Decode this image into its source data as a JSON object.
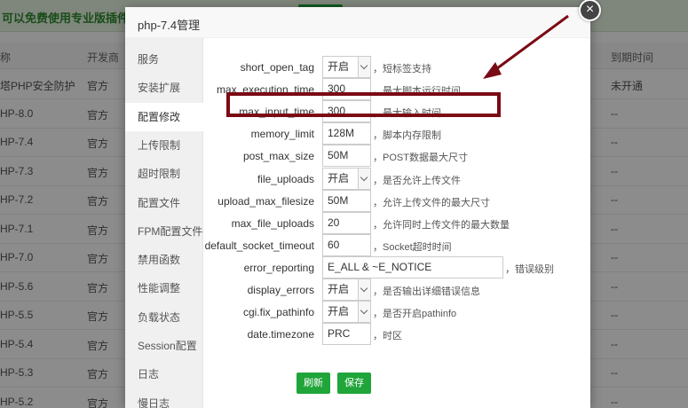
{
  "background": {
    "banner_text": "可以免费使用专业版插件，请",
    "headers": {
      "name": "称",
      "developer": "开发商",
      "expire": "到期时间"
    },
    "rows": [
      {
        "name": "塔PHP安全防护",
        "developer": "官方",
        "expire": "未开通"
      },
      {
        "name": "HP-8.0",
        "developer": "官方",
        "expire": "--"
      },
      {
        "name": "HP-7.4",
        "developer": "官方",
        "expire": "--"
      },
      {
        "name": "HP-7.3",
        "developer": "官方",
        "expire": "--"
      },
      {
        "name": "HP-7.2",
        "developer": "官方",
        "expire": "--"
      },
      {
        "name": "HP-7.1",
        "developer": "官方",
        "expire": "--"
      },
      {
        "name": "HP-7.0",
        "developer": "官方",
        "expire": "--"
      },
      {
        "name": "HP-5.6",
        "developer": "官方",
        "expire": "--"
      },
      {
        "name": "HP-5.5",
        "developer": "官方",
        "expire": "--"
      },
      {
        "name": "HP-5.4",
        "developer": "官方",
        "expire": "--"
      },
      {
        "name": "HP-5.3",
        "developer": "官方",
        "expire": "--"
      },
      {
        "name": "HP-5.2",
        "developer": "官方",
        "expire": "--"
      }
    ]
  },
  "dialog": {
    "title": "php-7.4管理",
    "close_icon": "×",
    "sidebar": [
      "服务",
      "安装扩展",
      "配置修改",
      "上传限制",
      "超时限制",
      "配置文件",
      "FPM配置文件",
      "禁用函数",
      "性能调整",
      "负载状态",
      "Session配置",
      "日志",
      "慢日志"
    ],
    "active_index": 2,
    "form": [
      {
        "label": "short_open_tag",
        "value": "开启",
        "select": true,
        "desc": "，短标签支持"
      },
      {
        "label": "max_execution_time",
        "value": "300",
        "select": false,
        "desc": "，最大脚本运行时间"
      },
      {
        "label": "max_input_time",
        "value": "300",
        "select": false,
        "desc": "，最大输入时间"
      },
      {
        "label": "memory_limit",
        "value": "128M",
        "select": false,
        "desc": "，脚本内存限制"
      },
      {
        "label": "post_max_size",
        "value": "50M",
        "select": false,
        "desc": "，POST数据最大尺寸"
      },
      {
        "label": "file_uploads",
        "value": "开启",
        "select": true,
        "desc": "，是否允许上传文件"
      },
      {
        "label": "upload_max_filesize",
        "value": "50M",
        "select": false,
        "desc": "，允许上传文件的最大尺寸"
      },
      {
        "label": "max_file_uploads",
        "value": "20",
        "select": false,
        "desc": "，允许同时上传文件的最大数量"
      },
      {
        "label": "default_socket_timeout",
        "value": "60",
        "select": false,
        "desc": "，Socket超时时间"
      },
      {
        "label": "error_reporting",
        "value": "E_ALL & ~E_NOTICE",
        "select": false,
        "desc": "，错误级别"
      },
      {
        "label": "display_errors",
        "value": "开启",
        "select": true,
        "desc": "，是否输出详细错误信息"
      },
      {
        "label": "cgi.fix_pathinfo",
        "value": "开启",
        "select": true,
        "desc": "，是否开启pathinfo"
      },
      {
        "label": "date.timezone",
        "value": "PRC",
        "select": false,
        "desc": "，时区"
      }
    ],
    "buttons": {
      "refresh": "刷新",
      "save": "保存"
    }
  },
  "colors": {
    "accent": "#20a53a",
    "highlight": "#7a0a14"
  }
}
